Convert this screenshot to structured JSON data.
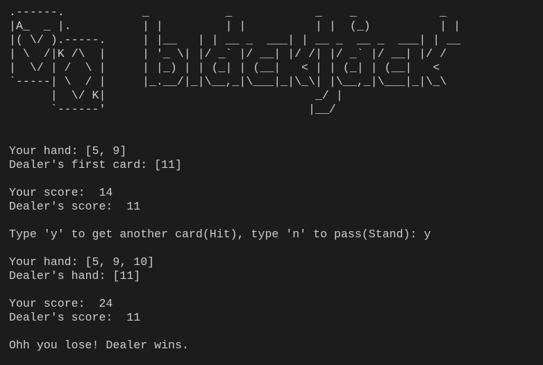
{
  "ascii": {
    "card_art": ".------.\n|A_  _ |.\n|( \\/ ).-----.\n| \\  /|K /\\  |\n|  \\/ | /  \\ |\n`-----| \\  / |\n      |  \\/ K|\n      `------'",
    "logo_art": "_           _            _    _            _\n| |         | |          | |  (_)          | |\n| |__   | | __ _  ___| | __ _  __ _  ___| | __\n| '_ \\| |/ _` |/ __| |/ /| |/ _` |/ __| |/ /\n| |_) | | (_| | (__|   < | | (_| | (__|   <\n|_.__/|_|\\__,_|\\___|_|\\_\\| |\\__,_|\\___|_|\\_\\\n                         _/ |\n                        |__/"
  },
  "session": {
    "hand1": "Your hand: [5, 9]",
    "dealer_first": "Dealer's first card: [11]",
    "score1": "Your score:  14",
    "dealer_score1": "Dealer's score:  11",
    "prompt": "Type 'y' to get another card(Hit), type 'n' to pass(Stand): y",
    "hand2": "Your hand: [5, 9, 10]",
    "dealer_hand": "Dealer's hand: [11]",
    "score2": "Your score:  24",
    "dealer_score2": "Dealer's score:  11",
    "result": "Ohh you lose! Dealer wins."
  }
}
